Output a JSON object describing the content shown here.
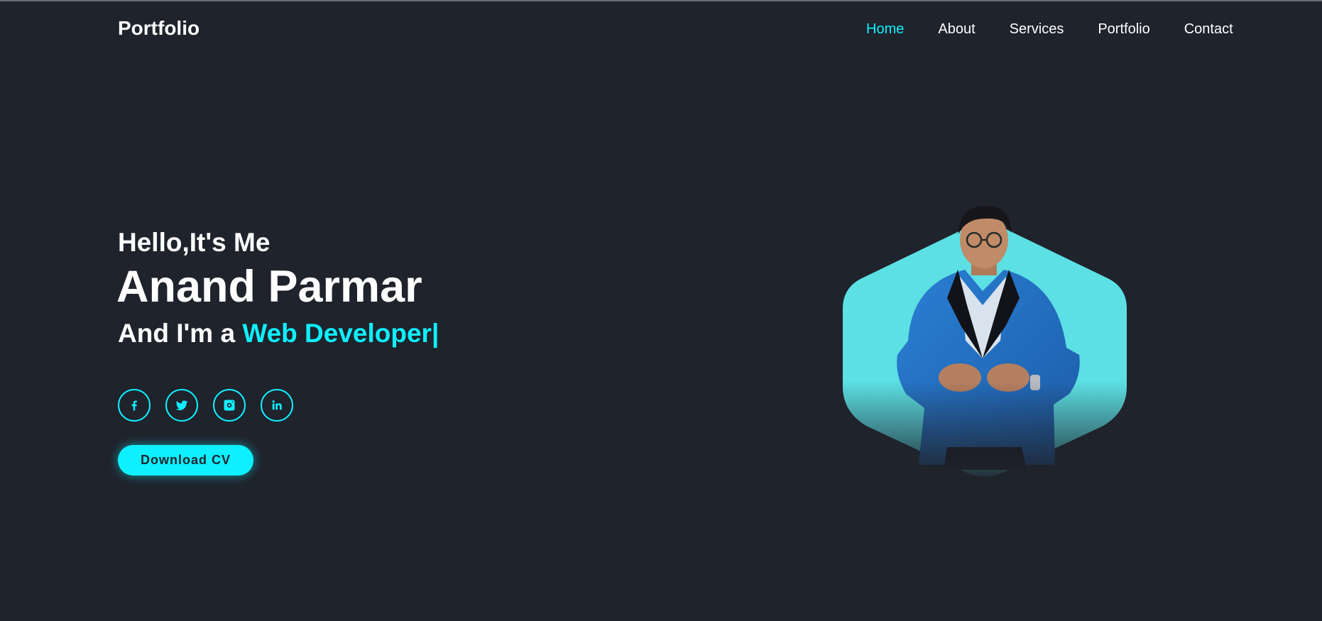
{
  "header": {
    "logo": "Portfolio",
    "nav": [
      {
        "label": "Home",
        "active": true
      },
      {
        "label": "About",
        "active": false
      },
      {
        "label": "Services",
        "active": false
      },
      {
        "label": "Portfolio",
        "active": false
      },
      {
        "label": "Contact",
        "active": false
      }
    ]
  },
  "hero": {
    "greeting": "Hello,It's Me",
    "name": "Anand Parmar",
    "role_prefix": "And I'm a ",
    "role_highlight": "Web Developer|",
    "socials": [
      {
        "icon": "facebook-icon"
      },
      {
        "icon": "twitter-icon"
      },
      {
        "icon": "instagram-icon"
      },
      {
        "icon": "linkedin-icon"
      }
    ],
    "cv_button": "Download CV"
  },
  "colors": {
    "background": "#1f232c",
    "accent": "#0ef0ff",
    "hexagon": "#5ce0e4",
    "text": "#ffffff"
  }
}
